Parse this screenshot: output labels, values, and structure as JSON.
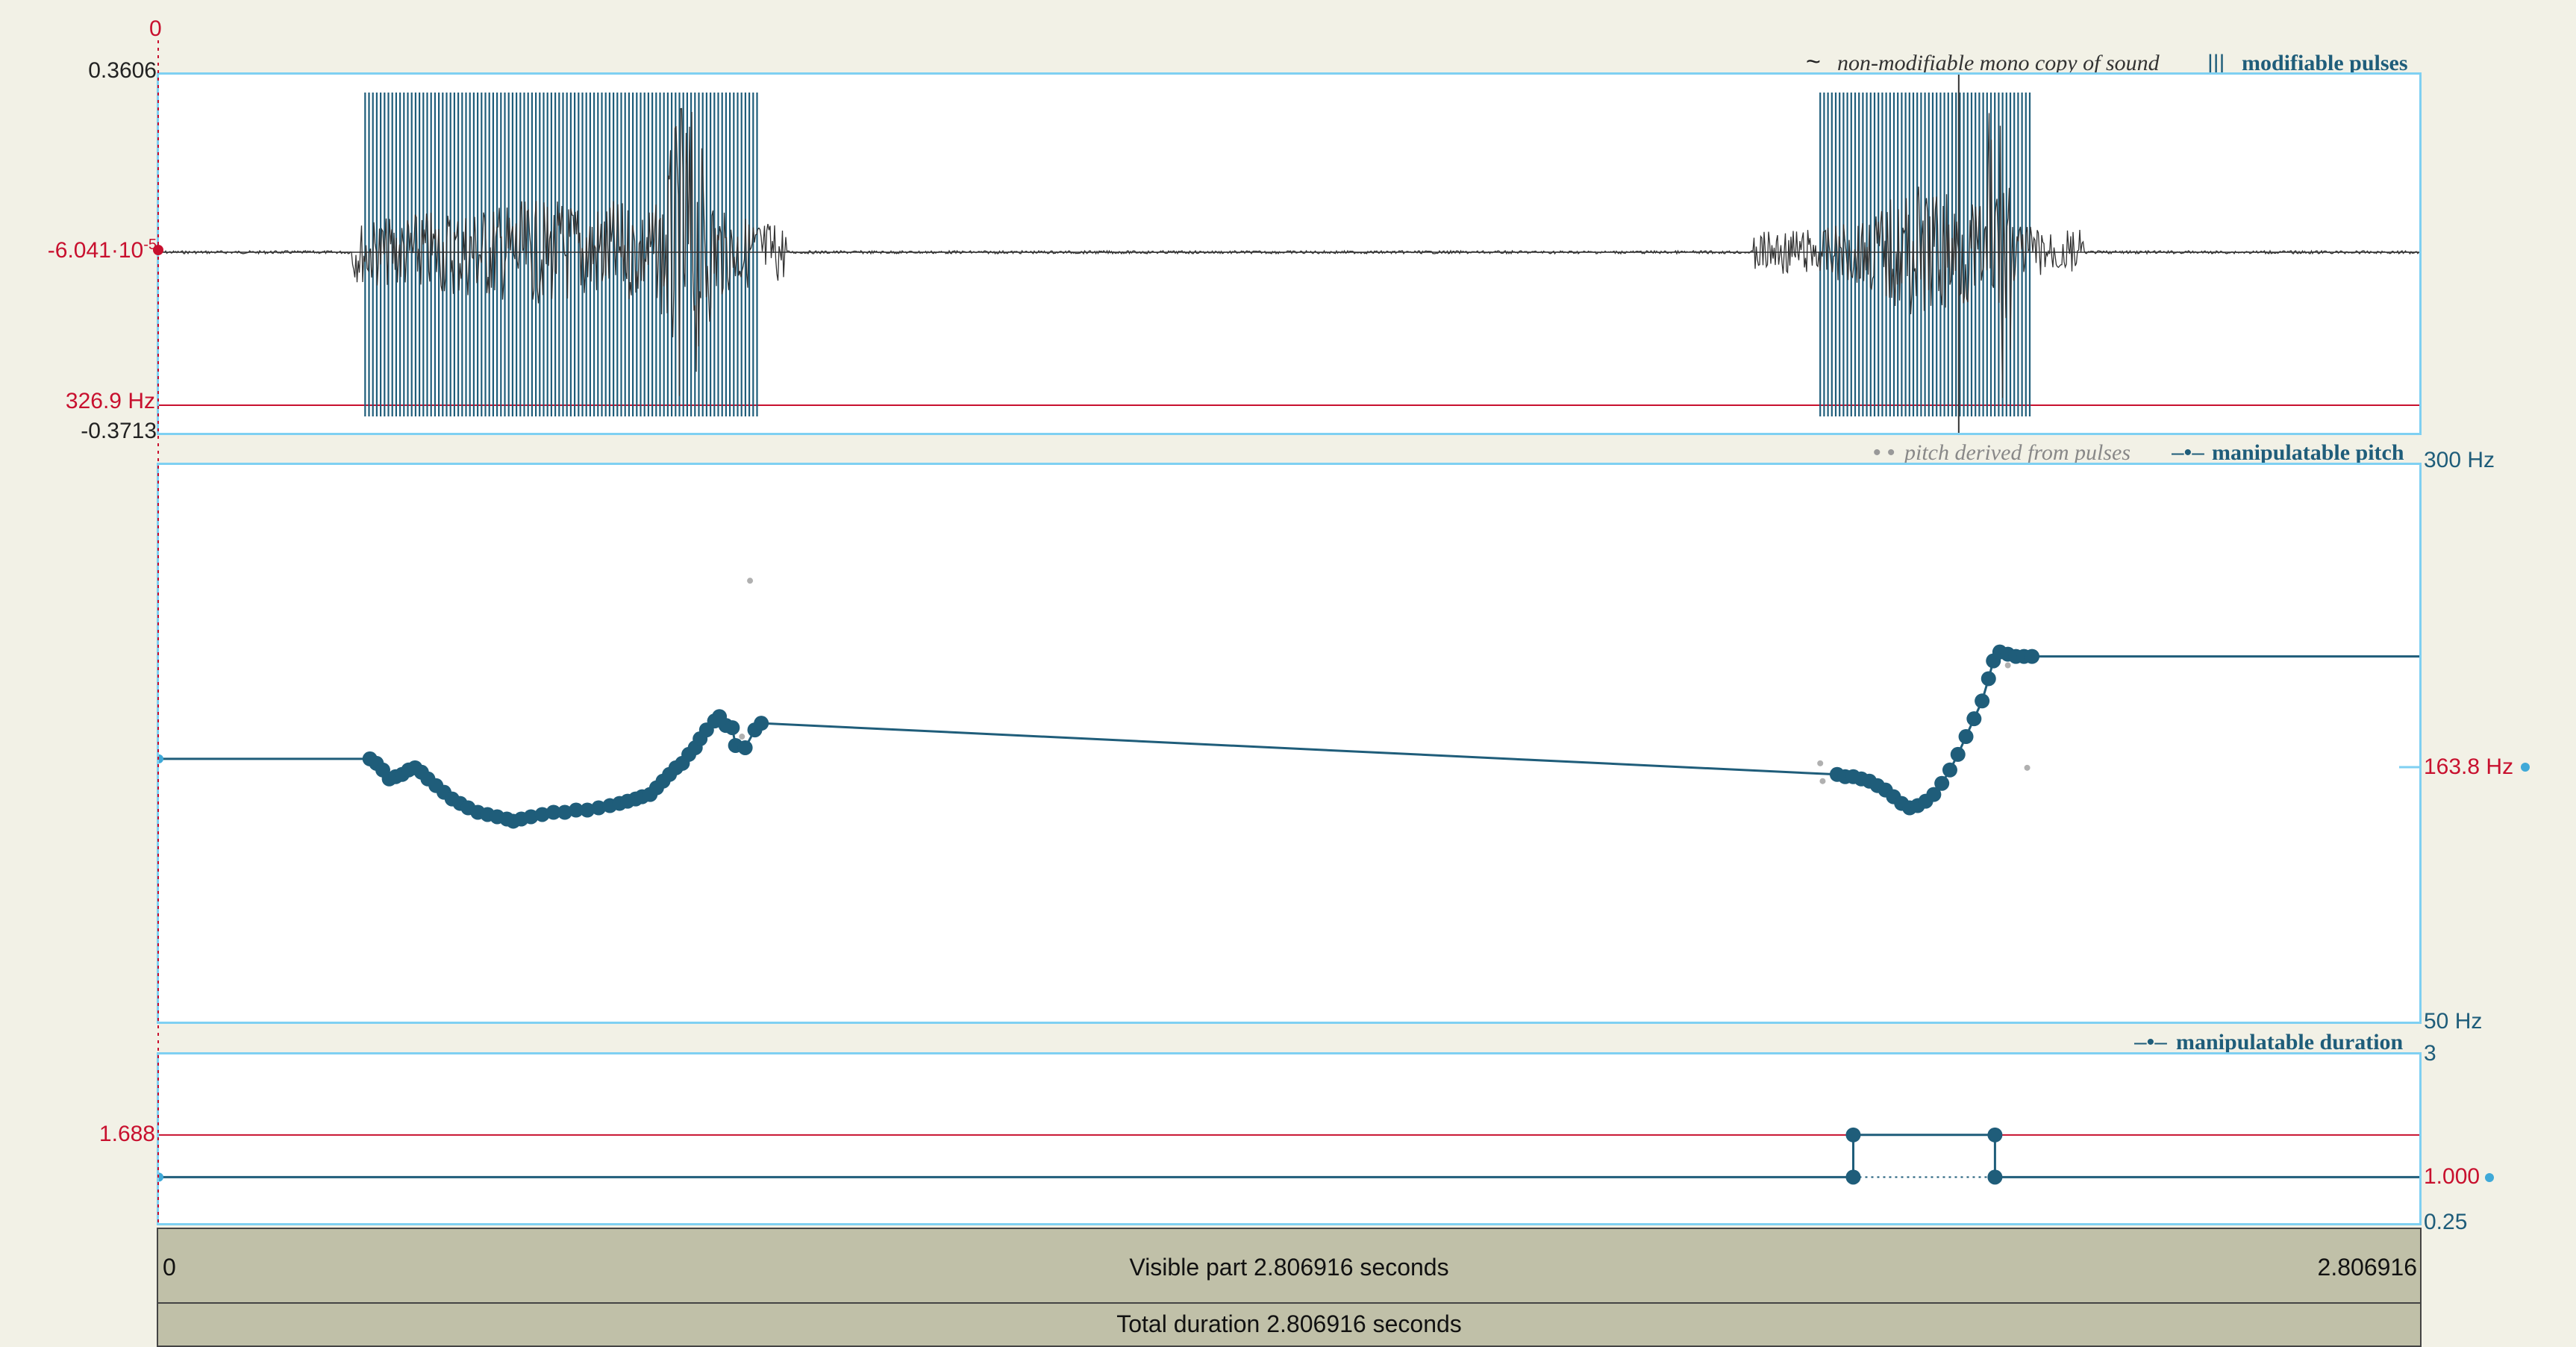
{
  "sound": {
    "y_top": "0.3606",
    "y_mid_pre": "-6.041·10",
    "y_mid_exp": "-5",
    "y_bottom": "-0.3713",
    "cursor_top": "0",
    "pitch_mark": "326.9 Hz",
    "legend_sound_glyph": "~",
    "legend_sound": "non-modifiable mono copy of sound",
    "legend_pulses_glyph": "|||",
    "legend_pulses": "modifiable pulses"
  },
  "pitch": {
    "legend_derived_glyph": "• •",
    "legend_derived": "pitch derived from pulses",
    "legend_manip_glyph": "–•–",
    "legend_manip": "manipulatable pitch",
    "y_top": "300 Hz",
    "y_cursor": "163.8 Hz",
    "y_bottom": "50 Hz"
  },
  "duration": {
    "legend_glyph": "–•–",
    "legend": "manipulatable duration",
    "y_top": "3",
    "y_red": "1.688",
    "y_cursor": "1.000",
    "y_bottom": "0.25"
  },
  "timebar": {
    "left": "0",
    "visible": "Visible part 2.806916 seconds",
    "right": "2.806916",
    "total": "Total duration 2.806916 seconds"
  },
  "colors": {
    "panel_border": "#7fd0f2",
    "curve": "#1f5d7a",
    "red_marker": "#c8102e",
    "waveform": "#333333",
    "background": "#f2f1e6"
  },
  "pulses": {
    "segments": [
      {
        "t0": 0.256,
        "t1": 0.747
      },
      {
        "t0": 2.063,
        "t1": 2.326
      }
    ]
  },
  "pitch_points": {
    "segment1": [
      [
        0.262,
        168
      ],
      [
        0.27,
        166
      ],
      [
        0.278,
        163
      ],
      [
        0.286,
        159
      ],
      [
        0.294,
        160
      ],
      [
        0.302,
        161
      ],
      [
        0.31,
        163
      ],
      [
        0.318,
        164
      ],
      [
        0.326,
        162
      ],
      [
        0.334,
        159
      ],
      [
        0.344,
        156
      ],
      [
        0.354,
        153
      ],
      [
        0.364,
        150
      ],
      [
        0.374,
        148
      ],
      [
        0.384,
        146
      ],
      [
        0.396,
        144
      ],
      [
        0.408,
        143
      ],
      [
        0.42,
        142
      ],
      [
        0.432,
        141
      ],
      [
        0.44,
        140
      ],
      [
        0.45,
        141
      ],
      [
        0.462,
        142
      ],
      [
        0.476,
        143
      ],
      [
        0.49,
        144
      ],
      [
        0.504,
        144
      ],
      [
        0.518,
        145
      ],
      [
        0.532,
        145
      ],
      [
        0.546,
        146
      ],
      [
        0.56,
        147
      ],
      [
        0.572,
        148
      ],
      [
        0.582,
        149
      ],
      [
        0.592,
        150
      ],
      [
        0.6,
        151
      ],
      [
        0.61,
        152
      ],
      [
        0.618,
        155
      ],
      [
        0.626,
        158
      ],
      [
        0.634,
        161
      ],
      [
        0.642,
        164
      ],
      [
        0.65,
        166
      ],
      [
        0.658,
        170
      ],
      [
        0.666,
        173
      ],
      [
        0.672,
        177
      ],
      [
        0.68,
        181
      ],
      [
        0.69,
        185
      ],
      [
        0.696,
        187
      ],
      [
        0.704,
        183
      ],
      [
        0.712,
        182
      ],
      [
        0.716,
        174
      ],
      [
        0.728,
        173
      ],
      [
        0.74,
        181
      ],
      [
        0.748,
        184
      ]
    ],
    "segment2": [
      [
        2.084,
        161
      ],
      [
        2.094,
        160
      ],
      [
        2.104,
        160
      ],
      [
        2.114,
        159
      ],
      [
        2.124,
        158
      ],
      [
        2.134,
        156
      ],
      [
        2.144,
        154
      ],
      [
        2.154,
        151
      ],
      [
        2.164,
        148
      ],
      [
        2.174,
        146
      ],
      [
        2.184,
        147
      ],
      [
        2.194,
        149
      ],
      [
        2.204,
        152
      ],
      [
        2.214,
        157
      ],
      [
        2.224,
        163
      ],
      [
        2.234,
        170
      ],
      [
        2.244,
        178
      ],
      [
        2.254,
        186
      ],
      [
        2.264,
        194
      ],
      [
        2.272,
        204
      ],
      [
        2.278,
        212
      ],
      [
        2.286,
        216
      ],
      [
        2.296,
        215
      ],
      [
        2.306,
        214
      ],
      [
        2.316,
        214
      ],
      [
        2.326,
        214
      ]
    ],
    "derived": [
      [
        0.262,
        168
      ],
      [
        0.734,
        248
      ],
      [
        0.724,
        178
      ],
      [
        2.063,
        166
      ],
      [
        2.066,
        158
      ],
      [
        2.296,
        210
      ],
      [
        2.32,
        164
      ]
    ]
  },
  "duration_points": [
    {
      "t": 0.0,
      "v": 1.0
    },
    {
      "t": 2.104,
      "v": 1.0
    },
    {
      "t": 2.104,
      "v": 1.688
    },
    {
      "t": 2.28,
      "v": 1.688
    },
    {
      "t": 2.28,
      "v": 1.0
    },
    {
      "t": 2.806916,
      "v": 1.0
    }
  ]
}
